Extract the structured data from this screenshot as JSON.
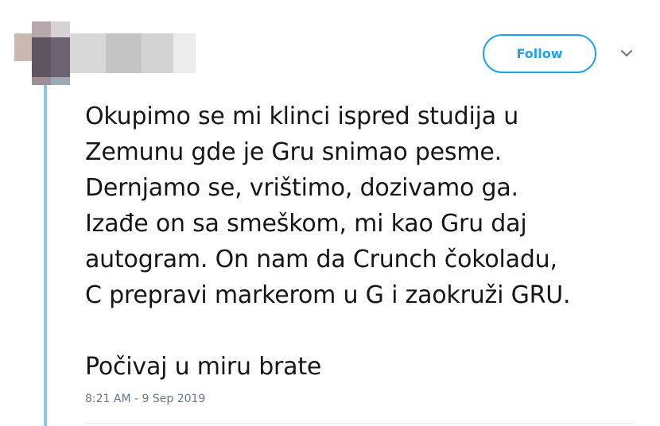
{
  "tweet": {
    "follow_label": "Follow",
    "text_lines": [
      "Okupimo se mi klinci ispred studija u",
      "Zemunu gde je Gru snimao pesme.",
      "Dernjamo se, vrištimo, dozivamo ga.",
      "Izađe on sa smeškom, mi kao Gru daj",
      "autogram. On nam da Crunch čokoladu,",
      "C prepravi markerom u G i zaokruži GRU."
    ],
    "closing_line": "Počivaj u miru brate",
    "timestamp": "8:21 AM - 9 Sep 2019"
  },
  "colors": {
    "accent": "#1da1f2",
    "thread_line": "#8ec7e5",
    "text": "#14171a",
    "muted": "#657786"
  },
  "icons": {
    "caret": "chevron-down-icon"
  }
}
